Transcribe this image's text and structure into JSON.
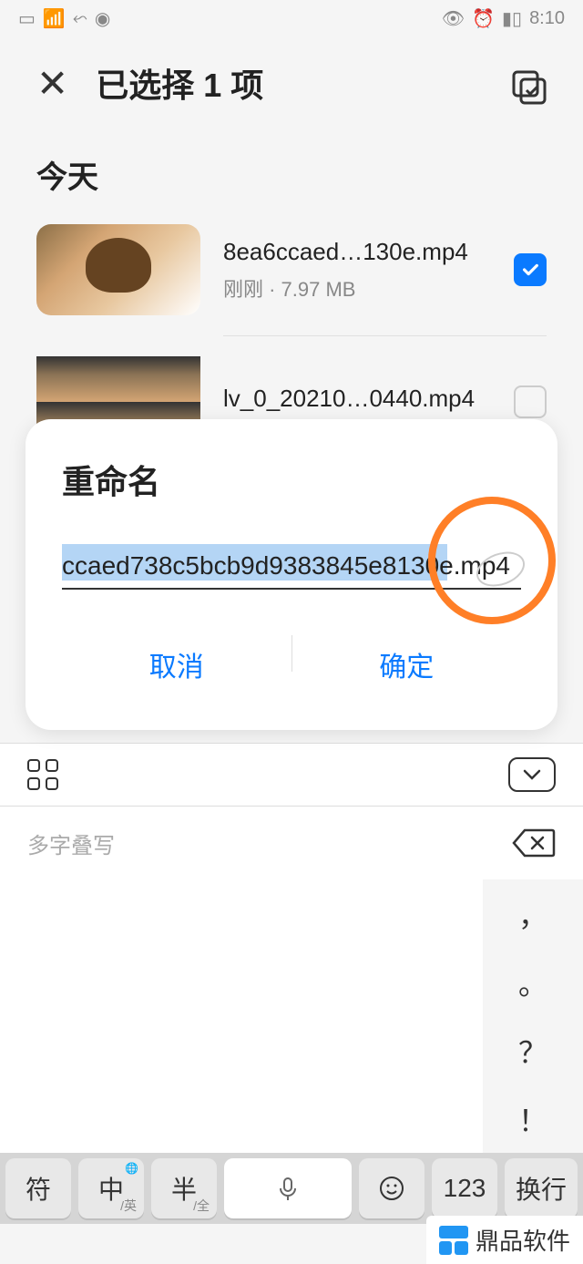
{
  "status_bar": {
    "time": "8:10"
  },
  "header": {
    "title": "已选择 1 项"
  },
  "section": {
    "label": "今天"
  },
  "files": [
    {
      "name": "8ea6ccaed…130e.mp4",
      "meta": "刚刚 · 7.97 MB",
      "checked": true
    },
    {
      "name": "lv_0_20210…0440.mp4",
      "meta": "",
      "checked": false
    }
  ],
  "dialog": {
    "title": "重命名",
    "input_value": "ccaed738c5bcb9d9383845e8130e.mp4",
    "cancel": "取消",
    "confirm": "确定"
  },
  "ime": {
    "suggest": "多字叠写",
    "puncts": [
      "，",
      "。",
      "？",
      "！"
    ],
    "keys": {
      "sym": "符",
      "lang_main": "中",
      "lang_sub": "/英",
      "half_main": "半",
      "half_sub": "/全",
      "num": "123",
      "enter": "换行"
    }
  },
  "watermark": "鼎品软件"
}
